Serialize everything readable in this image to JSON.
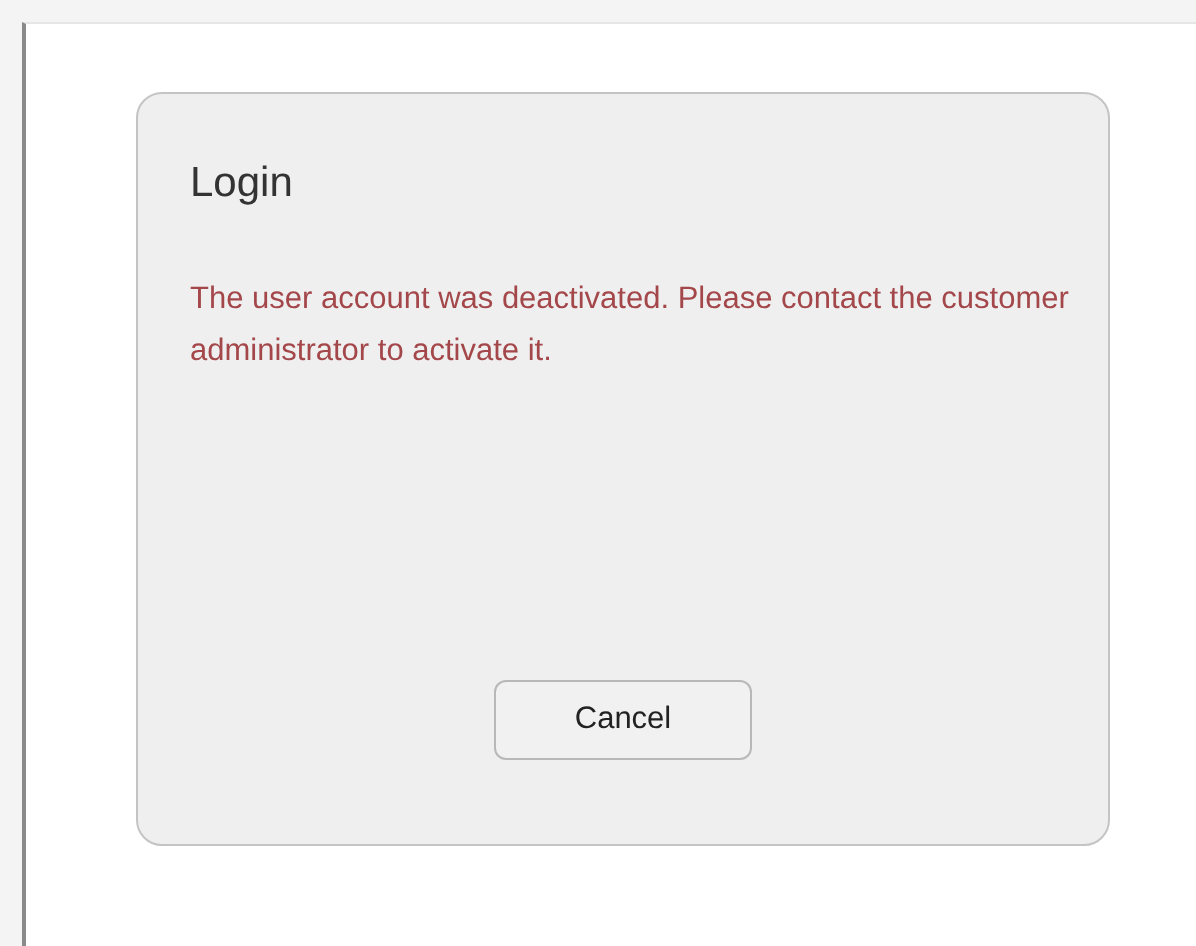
{
  "dialog": {
    "title": "Login",
    "message": "The user account was deactivated. Please contact the customer administrator to activate it.",
    "buttons": [
      "Cancel"
    ]
  }
}
